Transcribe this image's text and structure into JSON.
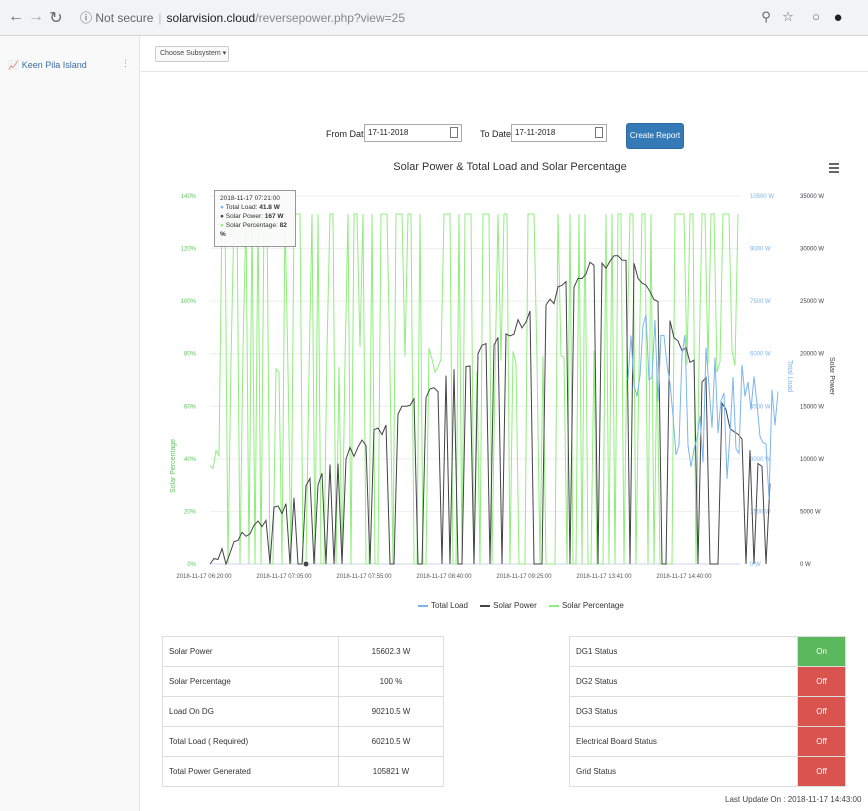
{
  "browser": {
    "security_label": "Not secure",
    "domain": "solarvision.cloud",
    "path": "/reversepower.php?view=25",
    "icons": [
      "back-icon",
      "forward-icon",
      "reload-icon",
      "info-icon",
      "zoom-icon",
      "star-icon",
      "extension-icon",
      "profile-icon"
    ]
  },
  "sidebar": {
    "items": [
      {
        "label": "Keen Pila Island",
        "icon": "chart-icon"
      }
    ]
  },
  "toolbar": {
    "subsystem_select": "Choose Subsystem ▾"
  },
  "filters": {
    "from_label": "From Date :",
    "from_value": "17-11-2018",
    "to_label": "To Date :",
    "to_value": "17-11-2018",
    "report_button": "Create Report"
  },
  "chart_data": {
    "type": "line",
    "title": "Solar Power & Total Load and Solar Percentage",
    "x_ticks": [
      "2018-11-17 06:20:00",
      "2018-11-17 07:05:00",
      "2018-11-17 07:55:00",
      "2018-11-17 08:40:00",
      "2018-11-17 09:25:00",
      "2018-11-17 13:41:00",
      "2018-11-17 14:40:00"
    ],
    "axes": {
      "left": {
        "label": "Solar Percentage",
        "ticks": [
          "0%",
          "20%",
          "40%",
          "60%",
          "80%",
          "100%",
          "120%",
          "140%"
        ],
        "color": "#5ec45e"
      },
      "right_inner": {
        "label": "Total Load",
        "ticks": [
          "0 W",
          "1500 W",
          "3000 W",
          "4500 W",
          "6000 W",
          "7500 W",
          "9000 W",
          "10500 W"
        ],
        "color": "#7cb5ec"
      },
      "right_outer": {
        "label": "Solar Power",
        "ticks": [
          "0 W",
          "5000 W",
          "10000 W",
          "15000 W",
          "20000 W",
          "25000 W",
          "30000 W",
          "35000 W"
        ],
        "color": "#434348"
      }
    },
    "series": [
      {
        "name": "Total Load",
        "color": "#7cb5ec"
      },
      {
        "name": "Solar Power",
        "color": "#434348"
      },
      {
        "name": "Solar Percentage",
        "color": "#90ed7d"
      }
    ],
    "tooltip": {
      "time": "2018-11-17 07:21:00",
      "rows": [
        {
          "label": "Total Load:",
          "value": "41.8 W"
        },
        {
          "label": "Solar Power:",
          "value": "167 W"
        },
        {
          "label": "Solar Percentage:",
          "value": "82 %"
        }
      ]
    }
  },
  "summary_left": [
    {
      "label": "Solar Power",
      "value": "15602.3 W"
    },
    {
      "label": "Solar Percentage",
      "value": "100 %"
    },
    {
      "label": "Load On DG",
      "value": "90210.5 W"
    },
    {
      "label": "Total Load ( Required)",
      "value": "60210.5 W"
    },
    {
      "label": "Total Power Generated",
      "value": "105821 W"
    }
  ],
  "summary_right": [
    {
      "label": "DG1 Status",
      "value": "On",
      "color": "#5cb85c"
    },
    {
      "label": "DG2 Status",
      "value": "Off",
      "color": "#d9534f"
    },
    {
      "label": "DG3 Status",
      "value": "Off",
      "color": "#d9534f"
    },
    {
      "label": "Electrical Board Status",
      "value": "Off",
      "color": "#d9534f"
    },
    {
      "label": "Grid Status",
      "value": "Off",
      "color": "#d9534f"
    }
  ],
  "footer": {
    "last_update": "Last Update On : 2018-11-17 14:43:00"
  }
}
